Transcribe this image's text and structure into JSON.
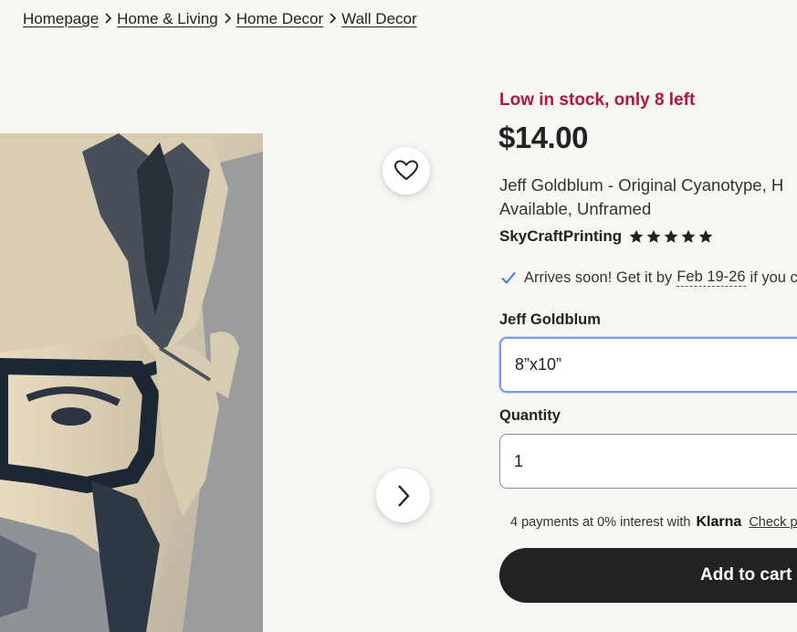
{
  "breadcrumb": {
    "items": [
      "Homepage",
      "Home & Living",
      "Home Decor",
      "Wall Decor"
    ]
  },
  "product": {
    "stock_notice": "Low in stock, only 8 left",
    "price": "$14.00",
    "title": "Jeff Goldblum - Original Cyanotype, H Available, Unframed",
    "shop_name": "SkyCraftPrinting",
    "rating_stars": 5
  },
  "shipping": {
    "prefix": "Arrives soon! Get it by",
    "dates": "Feb 19-26",
    "suffix": "if you c"
  },
  "variant": {
    "label": "Jeff Goldblum",
    "selected": "8”x10”"
  },
  "quantity": {
    "label": "Quantity",
    "selected": "1"
  },
  "klarna": {
    "text": "4 payments at 0% interest with",
    "brand": "Klarna",
    "link": "Check p"
  },
  "cart": {
    "label": "Add to cart"
  },
  "colors": {
    "stock": "#b3163d",
    "cart_bg": "#222222",
    "page_bg": "#f8f6f2",
    "focus": "#7c9ce6",
    "check": "#3b6fd6"
  }
}
